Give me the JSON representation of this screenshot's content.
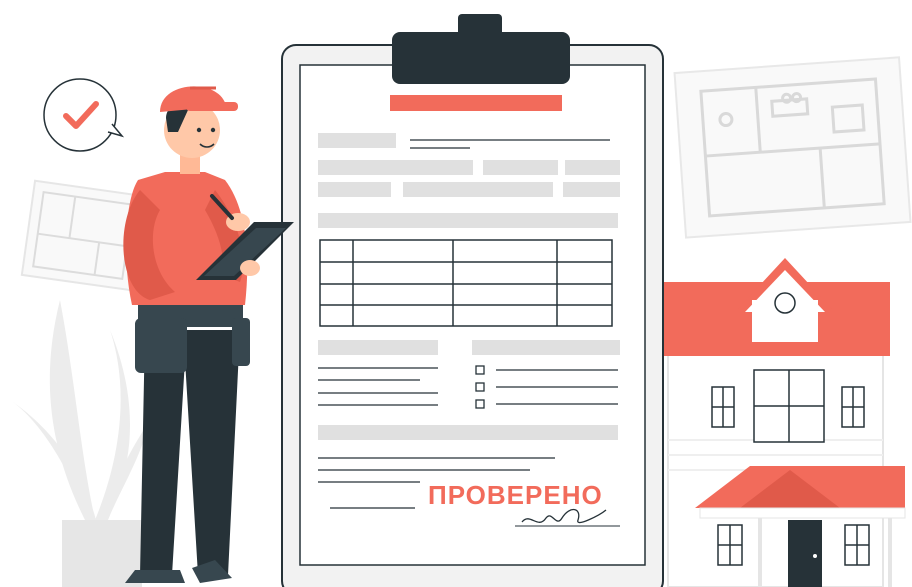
{
  "document": {
    "stamp_text": "ПРОВЕРЕНО",
    "checkbox_count": 3
  },
  "colors": {
    "accent": "#f26b5b",
    "dark": "#263238",
    "paper": "#ffffff",
    "clipboard": "#f2f2f2",
    "lines": "#e0e0e0",
    "sketch": "#ededed"
  },
  "icons": [
    "checkmark-icon",
    "house-icon",
    "plant-icon",
    "blueprint-icon",
    "signature-icon"
  ]
}
